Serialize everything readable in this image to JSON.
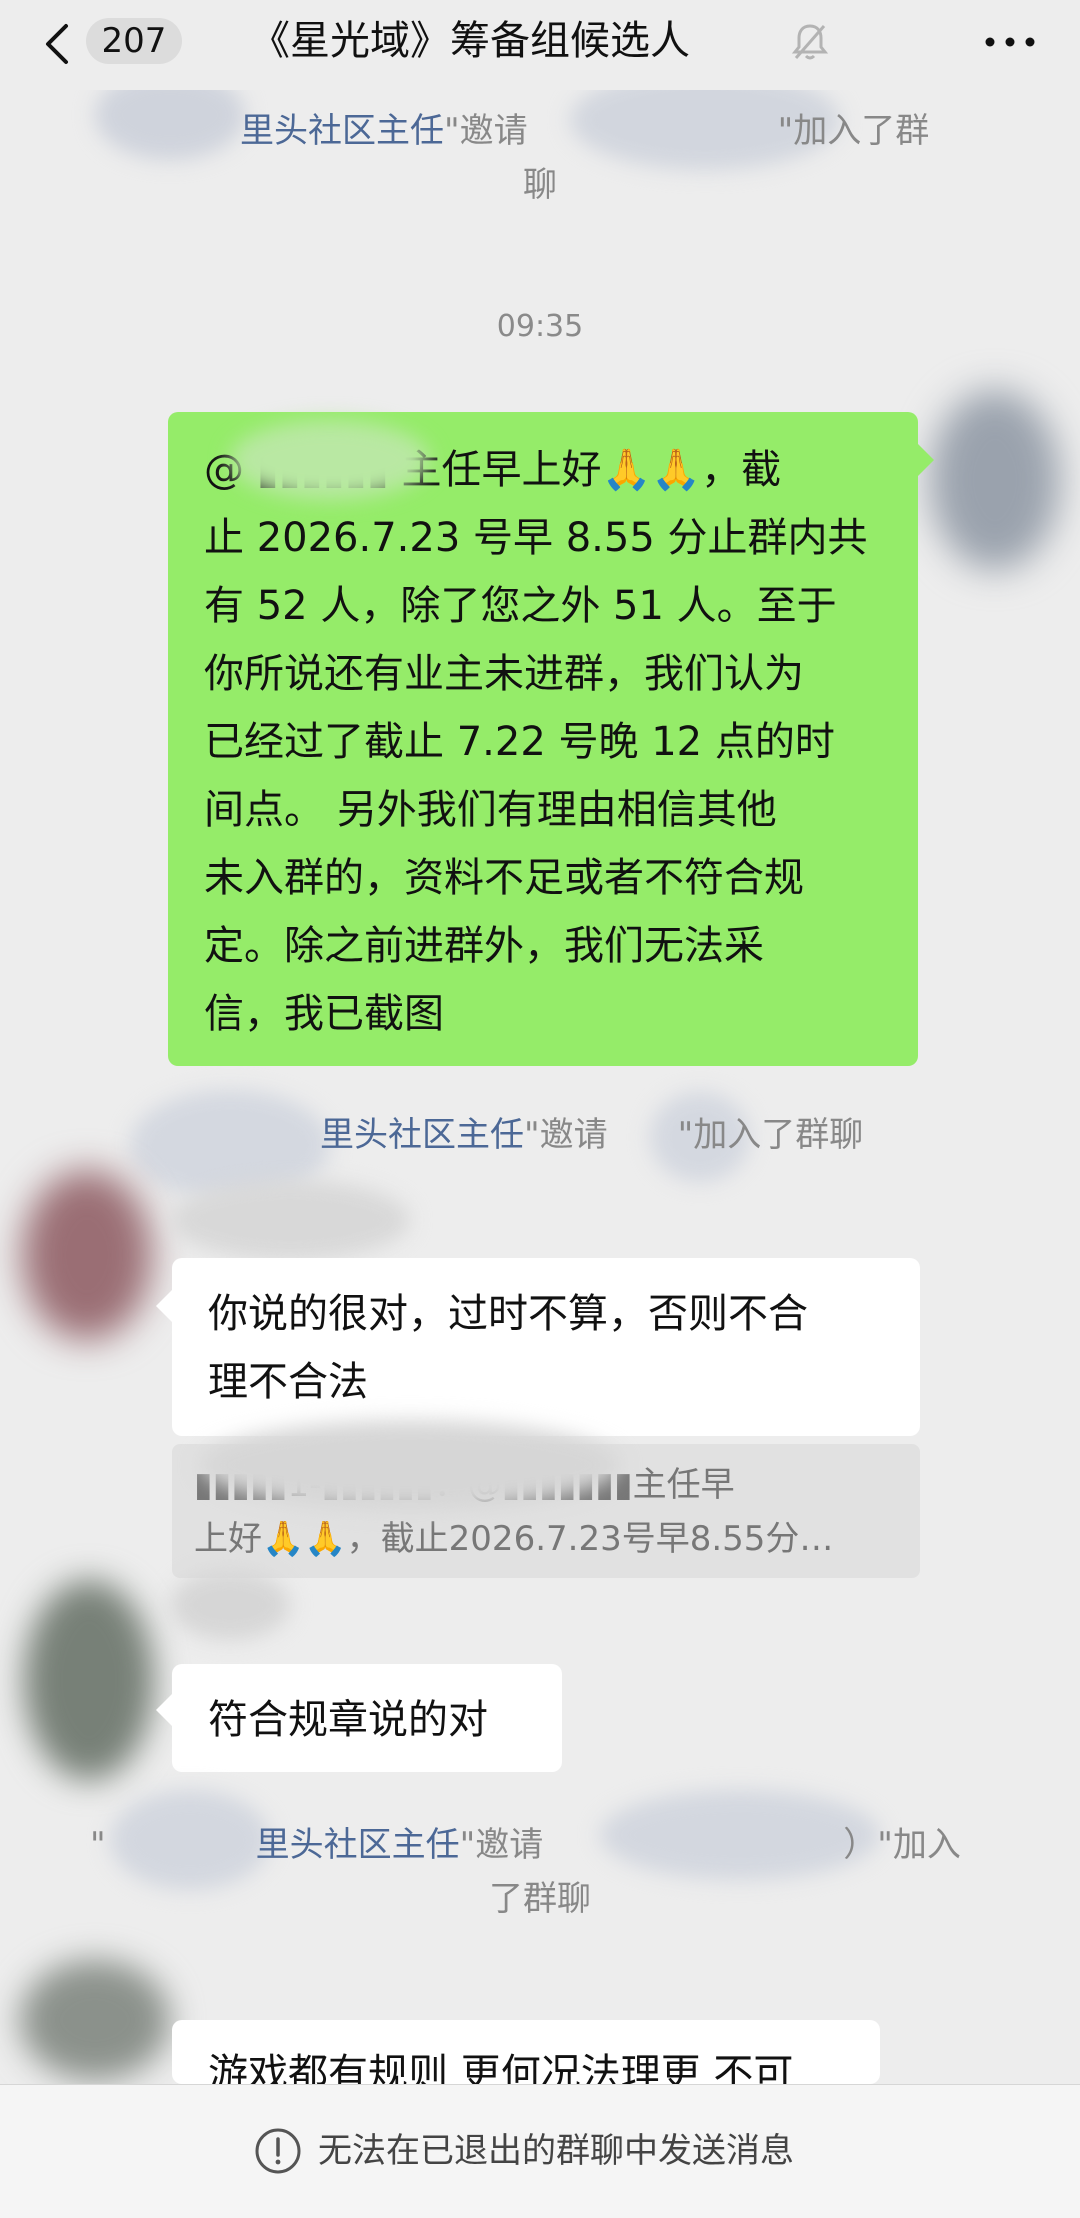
{
  "header": {
    "back_icon": "chevron-left-icon",
    "unread_count": "207",
    "title": "《星光域》筹备组候选人",
    "mute_icon": "bell-off-icon",
    "more_icon": "more-icon"
  },
  "messages": {
    "sys1": {
      "admin": "里头社区主任",
      "quote": "\"",
      "action": "邀请",
      "quote2": "\"",
      "tail": "加入了群",
      "tail2": "聊"
    },
    "time": "09:35",
    "green_message": "@ ▮▮▮▮▮▮ 主任早上好🙏🙏，截\n止 2026.7.23 号早 8.55 分止群内共\n有 52 人，除了您之外 51 人。至于\n你所说还有业主未进群，我们认为\n已经过了截止 7.22 号晚 12 点的时\n间点。 另外我们有理由相信其他\n未入群的，资料不足或者不符合规\n定。除之前进群外，我们无法采\n信，我已截图",
    "sys2": {
      "admin": "里头社区主任",
      "quote": "\"",
      "action": "邀请",
      "quote2": "\"",
      "tail": "加入了群聊"
    },
    "reply1": "你说的很对，过时不算，否则不合\n理不合法",
    "quoted": "▮▮▮▮▮1-▮▮▮▮▮▮：@▮▮▮▮▮▮▮主任早\n上好🙏🙏，截止2026.7.23号早8.55分…",
    "reply2": "符合规章说的对",
    "sys3": {
      "quote": "\"",
      "admin": "里头社区主任",
      "quote2": "\"",
      "action": "邀请",
      "tail": "）\"加入",
      "tail2": "了群聊"
    },
    "reply3": "游戏都有规则 更何况法理更 不可"
  },
  "footer": {
    "notice_icon": "exclamation-circle-icon",
    "notice": "无法在已退出的群聊中发送消息"
  },
  "colors": {
    "background": "#ededed",
    "green_bubble": "#95ec69",
    "admin_link": "#4c6896"
  }
}
